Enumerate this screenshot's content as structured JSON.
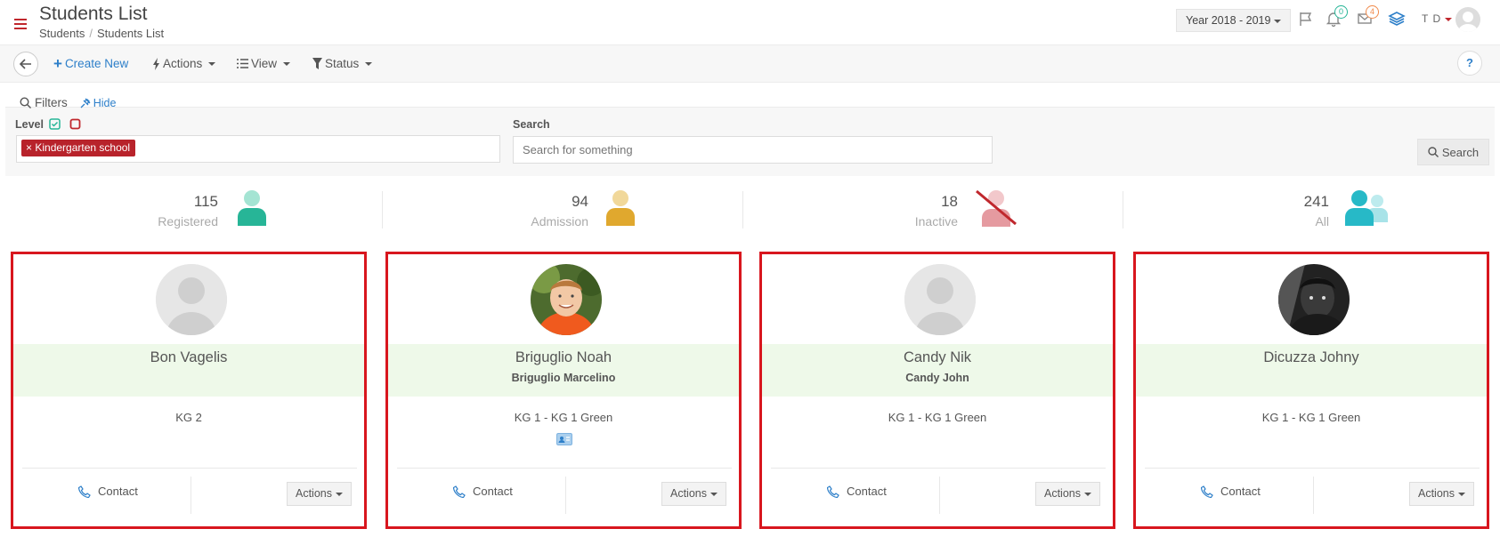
{
  "header": {
    "title": "Students List",
    "breadcrumb": [
      "Students",
      "Students List"
    ],
    "year_selector": "Year 2018 - 2019",
    "notifications_count": "0",
    "messages_count": "4",
    "user_initials": "T D"
  },
  "toolbar": {
    "create_label": "Create New",
    "actions_label": "Actions",
    "view_label": "View",
    "status_label": "Status",
    "help_label": "?"
  },
  "filters": {
    "title": "Filters",
    "hide_label": "Hide",
    "level_label": "Level",
    "level_tag": "Kindergarten school",
    "search_label": "Search",
    "search_placeholder": "Search for something",
    "search_button": "Search"
  },
  "stats": [
    {
      "value": "115",
      "label": "Registered",
      "color": "#27b597"
    },
    {
      "value": "94",
      "label": "Admission",
      "color": "#e0a82e"
    },
    {
      "value": "18",
      "label": "Inactive",
      "color": "#e59aa0"
    },
    {
      "value": "241",
      "label": "All",
      "color": "#27b9c7"
    }
  ],
  "students": [
    {
      "name": "Bon Vagelis",
      "parent": "",
      "class": "KG 2",
      "has_id_card": false,
      "photo": "placeholder",
      "contact": "Contact",
      "actions": "Actions"
    },
    {
      "name": "Briguglio Noah",
      "parent": "Briguglio Marcelino",
      "class": "KG 1  -  KG 1 Green",
      "has_id_card": true,
      "photo": "boy-smiling",
      "contact": "Contact",
      "actions": "Actions"
    },
    {
      "name": "Candy Nik",
      "parent": "Candy John",
      "class": "KG 1  -  KG 1 Green",
      "has_id_card": false,
      "photo": "placeholder",
      "contact": "Contact",
      "actions": "Actions"
    },
    {
      "name": "Dicuzza Johny",
      "parent": "",
      "class": "KG 1  -  KG 1 Green",
      "has_id_card": false,
      "photo": "child-bw",
      "contact": "Contact",
      "actions": "Actions"
    }
  ]
}
